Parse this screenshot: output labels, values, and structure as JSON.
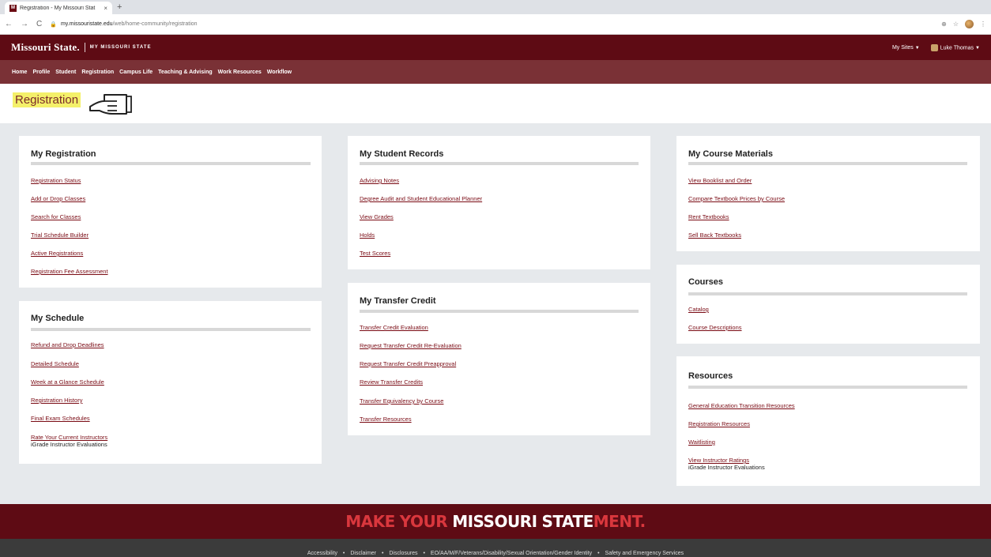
{
  "browser": {
    "tab_title": "Registration - My Missouri Stat",
    "favicon_letter": "M",
    "tab_close": "×",
    "new_tab": "+",
    "url_host": "my.missouristate.edu",
    "url_path": "/web/home-community/registration",
    "icons": [
      "back-icon",
      "forward-icon",
      "reload-icon",
      "lock-icon",
      "zoom-icon",
      "star-icon",
      "extension-icon",
      "menu-icon"
    ]
  },
  "header": {
    "brand": "Missouri State.",
    "brand_sub": "MY MISSOURI STATE",
    "my_sites": "My Sites",
    "user_name": "Luke Thomas",
    "caret": "▼"
  },
  "nav": {
    "items": [
      "Home",
      "Profile",
      "Student",
      "Registration",
      "Campus Life",
      "Teaching & Advising",
      "Work Resources",
      "Workflow"
    ]
  },
  "page": {
    "title": "Registration",
    "highlight_color": "#f4f06a"
  },
  "cards": {
    "my_registration": {
      "title": "My Registration",
      "links": [
        "Registration Status",
        "Add or Drop Classes",
        "Search for Classes",
        "Trial Schedule Builder",
        "Active Registrations",
        "Registration Fee Assessment"
      ]
    },
    "my_schedule": {
      "title": "My Schedule",
      "links": [
        "Refund and Drop Deadlines",
        "Detailed Schedule",
        "Week at a Glance Schedule",
        "Registration History",
        "Final Exam Schedules",
        "Rate Your Current Instructors"
      ],
      "note": "iGrade Instructor Evaluations"
    },
    "my_student_records": {
      "title": "My Student Records",
      "links": [
        "Advising Notes",
        "Degree Audit and Student Educational Planner",
        "View Grades",
        "Holds",
        "Test Scores"
      ]
    },
    "my_transfer_credit": {
      "title": "My Transfer Credit",
      "links": [
        "Transfer Credit Evaluation",
        "Request Transfer Credit Re-Evaluation",
        "Request Transfer Credit Preapproval",
        "Review Transfer Credits",
        "Transfer Equivalency by Course",
        "Transfer Resources"
      ]
    },
    "my_course_materials": {
      "title": "My Course Materials",
      "links": [
        "View Booklist and Order",
        "Compare Textbook Prices by Course",
        "Rent Textbooks",
        "Sell Back Textbooks"
      ]
    },
    "courses": {
      "title": "Courses",
      "links": [
        "Catalog",
        "Course Descriptions"
      ]
    },
    "resources": {
      "title": "Resources",
      "links": [
        "General Education Transition Resources",
        "Registration Resources",
        "Waitlisting",
        "View Instructor Ratings"
      ],
      "note": "iGrade Instructor Evaluations"
    }
  },
  "footer": {
    "banner_make": "MAKE",
    "banner_your": "YOUR",
    "banner_missouri": "MISSOURI",
    "banner_state": "STATE",
    "banner_ment": "MENT.",
    "links": [
      "Accessibility",
      "Disclaimer",
      "Disclosures",
      "EO/AA/M/F/Veterans/Disability/Sexual Orientation/Gender Identity",
      "Safety and Emergency Services"
    ],
    "separator": "•"
  },
  "colors": {
    "maroon": "#5e0b14",
    "nav_bg": "#7a3136",
    "link": "#7a0b14",
    "accent_red": "#d9373d",
    "page_bg": "#e6e9ec"
  }
}
